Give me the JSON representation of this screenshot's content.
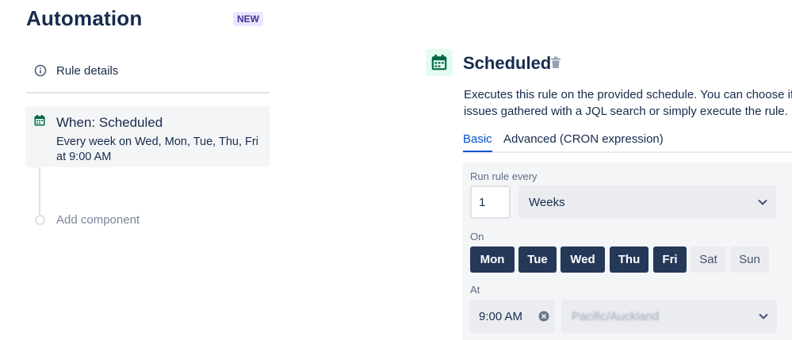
{
  "header": {
    "title": "Automation",
    "badge": "NEW"
  },
  "sidebar": {
    "rule_details_label": "Rule details",
    "trigger": {
      "heading": "When: Scheduled",
      "description": "Every week on Wed, Mon, Tue, Thu, Fri at 9:00 AM"
    },
    "add_component_label": "Add component"
  },
  "main": {
    "title": "Scheduled",
    "description_line1": "Executes this rule on the provided schedule. You can choose if y",
    "description_line2": "issues gathered with a JQL search or simply execute the rule.",
    "tabs": [
      {
        "label": "Basic",
        "active": true
      },
      {
        "label": "Advanced (CRON expression)",
        "active": false
      }
    ],
    "form": {
      "run_every_label": "Run rule every",
      "interval_value": "1",
      "interval_unit": "Weeks",
      "on_label": "On",
      "days": [
        {
          "label": "Mon",
          "selected": true
        },
        {
          "label": "Tue",
          "selected": true
        },
        {
          "label": "Wed",
          "selected": true
        },
        {
          "label": "Thu",
          "selected": true
        },
        {
          "label": "Fri",
          "selected": true
        },
        {
          "label": "Sat",
          "selected": false
        },
        {
          "label": "Sun",
          "selected": false
        }
      ],
      "at_label": "At",
      "time_value": "9:00 AM",
      "timezone_value": "Pacific/Auckland"
    }
  },
  "colors": {
    "accent": "#0052cc",
    "day_selected": "#253858",
    "calendar_green": "#006644",
    "badge_bg": "#eae6ff"
  },
  "icons": [
    "info-icon",
    "calendar-icon",
    "trash-icon",
    "chevron-down-icon",
    "clear-icon"
  ]
}
